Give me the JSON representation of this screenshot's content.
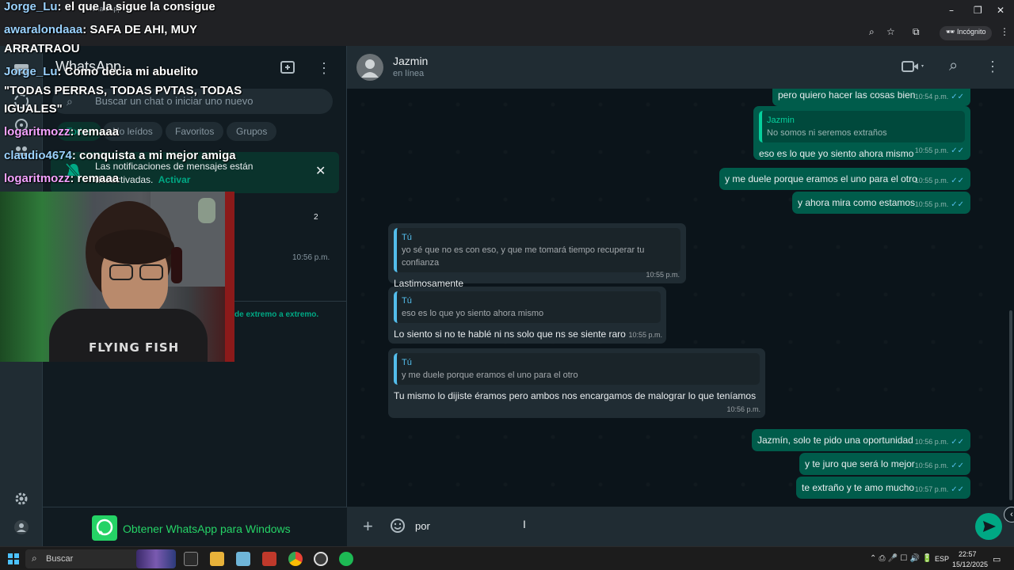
{
  "browser": {
    "tab_title": "WhatsApp",
    "incognito_label": "Incógnito"
  },
  "sidebar": {
    "search_placeholder": "Buscar un chat o iniciar uno nuevo",
    "filters": [
      "Todos",
      "No leídos",
      "Favoritos",
      "Grupos"
    ],
    "notice_line1": "Las notificaciones de mensajes están",
    "notice_line2": "desactivadas.",
    "notice_action": "Activar",
    "unread_count": "2",
    "chat_time": "10:56 p.m.",
    "encryption_note": "de extremo a extremo.",
    "get_app": "Obtener WhatsApp para Windows"
  },
  "chat": {
    "contact_name": "Jazmin",
    "contact_status": "en línea",
    "composer_text": "por"
  },
  "messages": [
    {
      "dir": "out",
      "text": "pero quiero hacer las cosas bien",
      "time": "10:54 p.m."
    },
    {
      "dir": "out",
      "quote_author": "Jazmin",
      "quote_text": "No somos ni seremos extraños",
      "text": "eso es lo que yo siento ahora mismo",
      "time": "10:55 p.m."
    },
    {
      "dir": "out",
      "text": "y me duele porque eramos el uno para el otro",
      "time": "10:55 p.m."
    },
    {
      "dir": "out",
      "text": "y ahora mira como estamos",
      "time": "10:55 p.m."
    },
    {
      "dir": "in",
      "quote_author": "Tú",
      "quote_text": "yo sé que no es con eso, y que me tomará tiempo recuperar tu confianza",
      "text": "Lastimosamente",
      "time": "10:55 p.m."
    },
    {
      "dir": "in",
      "quote_author": "Tú",
      "quote_text": "eso es lo que yo siento ahora mismo",
      "text": "Lo siento si no te hablé ni ns solo que ns se siente raro",
      "time": "10:55 p.m."
    },
    {
      "dir": "in",
      "quote_author": "Tú",
      "quote_text": "y me duele porque eramos el uno para el otro",
      "text": "Tu mismo lo dijiste éramos pero ambos nos encargamos de malograr lo que teníamos",
      "time": "10:56 p.m."
    },
    {
      "dir": "out",
      "text": "Jazmín, solo te pido una oportunidad",
      "time": "10:56 p.m."
    },
    {
      "dir": "out",
      "text": "y te juro que será lo mejor",
      "time": "10:56 p.m."
    },
    {
      "dir": "out",
      "text": "te extraño y te amo mucho",
      "time": "10:57 p.m."
    }
  ],
  "stream_chat": [
    {
      "user": "Jorge_Lu",
      "text": ": el que la sigue la consigue"
    },
    {
      "user": "awaralondaaa",
      "text": ": SAFA DE AHI, MUY"
    },
    {
      "user": "",
      "text": "ARRATRAOU"
    },
    {
      "user": "Jorge_Lu",
      "text": ": Como decia mi abuelito"
    },
    {
      "user": "",
      "text": "\"TODAS PERRAS, TODAS PVTAS, TODAS"
    },
    {
      "user": "",
      "text": "IGUALES\""
    },
    {
      "user": "logaritmozz",
      "text": ": remaaa"
    },
    {
      "user": "claudio4674",
      "text": ": conquista a mi mejor amiga"
    },
    {
      "user": "logaritmozz",
      "text": ": remaaa"
    }
  ],
  "webcam": {
    "shirt_text": "FLYING FISH"
  },
  "taskbar": {
    "search_label": "Buscar",
    "lang": "ESP",
    "time": "22:57",
    "date": "15/12/2025"
  },
  "colors": {
    "accent": "#00a884",
    "outgoing_bubble": "#005c4b",
    "incoming_bubble": "#202c33",
    "read_ticks": "#53bdeb"
  }
}
